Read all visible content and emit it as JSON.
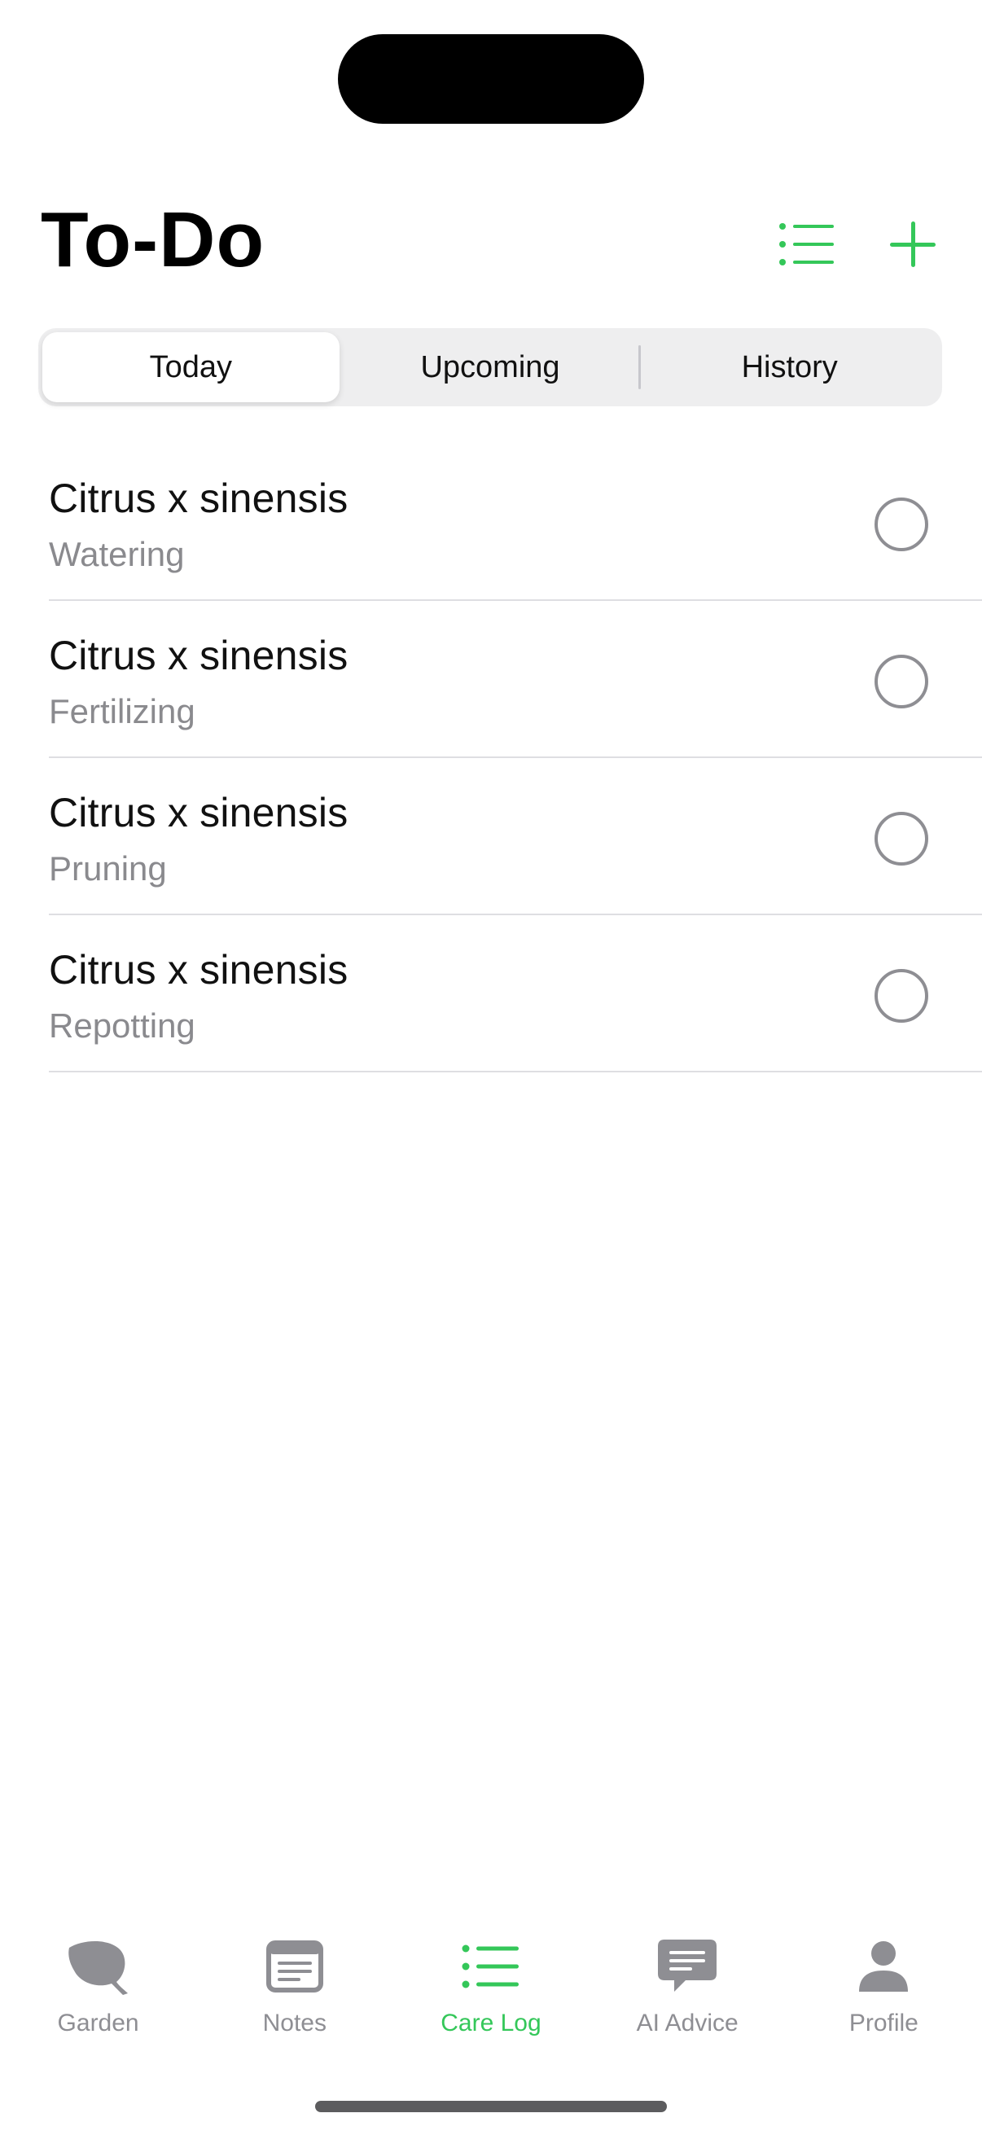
{
  "colors": {
    "accent": "#34c759",
    "inactive": "#8e8e93",
    "segment_bg": "#eeeeef"
  },
  "header": {
    "title": "To-Do",
    "list_icon": "list-bullet-icon",
    "add_icon": "plus-icon"
  },
  "segments": [
    {
      "label": "Today",
      "selected": true
    },
    {
      "label": "Upcoming",
      "selected": false
    },
    {
      "label": "History",
      "selected": false
    }
  ],
  "tasks": [
    {
      "plant": "Citrus x sinensis",
      "task": "Watering",
      "done": false
    },
    {
      "plant": "Citrus x sinensis",
      "task": "Fertilizing",
      "done": false
    },
    {
      "plant": "Citrus x sinensis",
      "task": "Pruning",
      "done": false
    },
    {
      "plant": "Citrus x sinensis",
      "task": "Repotting",
      "done": false
    }
  ],
  "tabbar": {
    "items": [
      {
        "label": "Garden",
        "icon": "leaf-icon",
        "active": false
      },
      {
        "label": "Notes",
        "icon": "note-icon",
        "active": false
      },
      {
        "label": "Care Log",
        "icon": "list-bullet-icon",
        "active": true
      },
      {
        "label": "AI Advice",
        "icon": "chat-bubble-icon",
        "active": false
      },
      {
        "label": "Profile",
        "icon": "person-icon",
        "active": false
      }
    ]
  }
}
